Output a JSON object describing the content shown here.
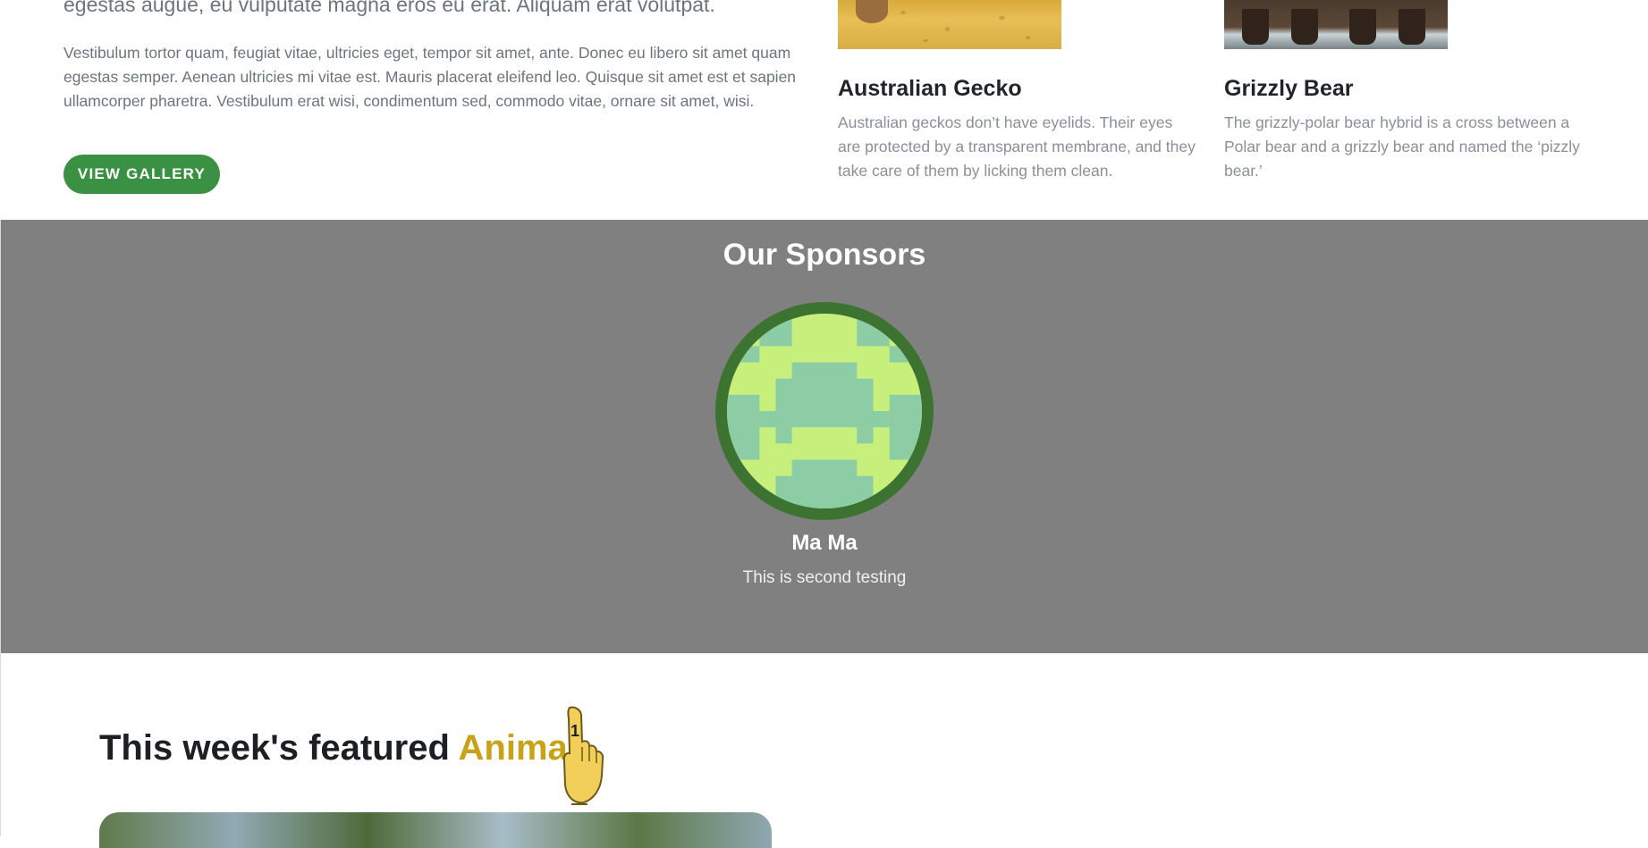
{
  "intro": {
    "lead_text": "egestas augue, eu vulputate magna eros eu erat. Aliquam erat volutpat.",
    "body_text": "Vestibulum tortor quam, feugiat vitae, ultricies eget, tempor sit amet, ante. Donec eu libero sit amet quam egestas semper. Aenean ultricies mi vitae est. Mauris placerat eleifend leo. Quisque sit amet est et sapien ullamcorper pharetra. Vestibulum erat wisi, condimentum sed, commodo vitae, ornare sit amet, wisi.",
    "button_label": "VIEW GALLERY"
  },
  "animal_cards": [
    {
      "title": "Australian Gecko",
      "text": "Australian geckos don’t have eyelids. Their eyes are protected by a transparent membrane, and they take care of them by licking them clean."
    },
    {
      "title": "Grizzly Bear",
      "text": "The grizzly-polar bear hybrid is a cross between a Polar bear and a grizzly bear and named the ‘pizzly bear.’"
    }
  ],
  "sponsors": {
    "title": "Our Sponsors",
    "items": [
      {
        "name": "Ma Ma",
        "description": "This is second testing"
      }
    ]
  },
  "featured": {
    "title_prefix": "This week's featured ",
    "title_accent": "Animal",
    "icon": "foam-finger-icon"
  },
  "colors": {
    "primary_green": "#3b9143",
    "accent_gold": "#c9a217",
    "sponsor_bg": "#808080",
    "logo_ring": "#3d7330",
    "logo_light": "#c6ef7c",
    "logo_teal": "#8ccda5"
  }
}
